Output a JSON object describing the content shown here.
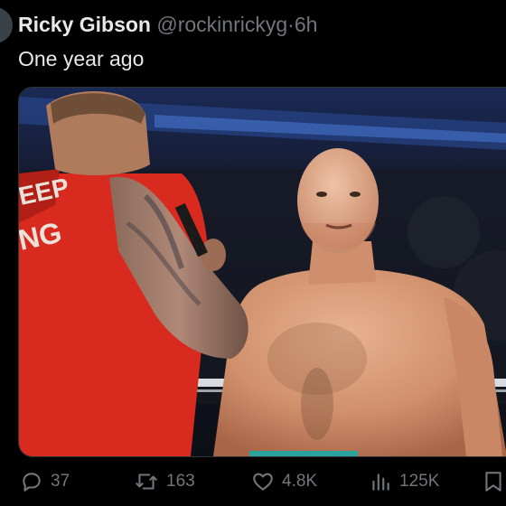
{
  "post": {
    "author_name": "Ricky Gibson",
    "handle": "@rockinrickyg",
    "separator": "·",
    "time": "6h",
    "text": "One year ago"
  },
  "media": {
    "shirt_text_line1": "EEP",
    "shirt_text_line2": "NG"
  },
  "actions": {
    "replies": "37",
    "reposts": "163",
    "likes": "4.8K",
    "views": "125K"
  },
  "icons": [
    "avatar",
    "reply-icon",
    "repost-icon",
    "like-icon",
    "views-icon",
    "bookmark-icon"
  ],
  "colors": {
    "background": "#000000",
    "text_primary": "#e7e9ea",
    "text_secondary": "#71767b",
    "shirt_red": "#d92a1f"
  }
}
